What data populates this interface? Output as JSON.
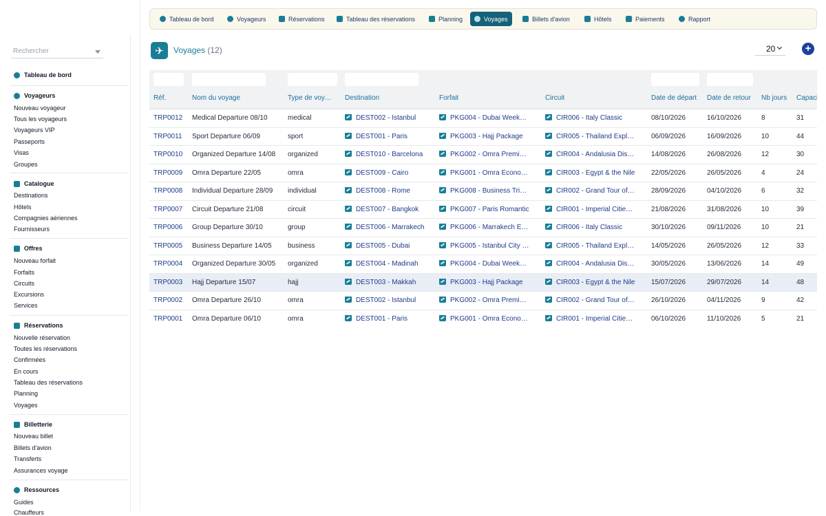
{
  "sidebar": {
    "search_placeholder": "Rechercher",
    "dashboard_label": "Tableau de bord",
    "sections": [
      {
        "title": "Voyageurs",
        "icon": "user-icon",
        "items": [
          "Nouveau voyageur",
          "Tous les voyageurs",
          "Voyageurs VIP",
          "Passeports",
          "Visas",
          "Groupes"
        ]
      },
      {
        "title": "Catalogue",
        "icon": "catalog-icon",
        "items": [
          "Destinations",
          "Hôtels",
          "Compagnies aériennes",
          "Fournisseurs"
        ]
      },
      {
        "title": "Offres",
        "icon": "offer-icon",
        "items": [
          "Nouveau forfait",
          "Forfaits",
          "Circuits",
          "Excursions",
          "Services"
        ]
      },
      {
        "title": "Réservations",
        "icon": "booking-icon",
        "items": [
          "Nouvelle réservation",
          "Toutes les réservations",
          "Confirmées",
          "En cours",
          "Tableau des réservations",
          "Planning",
          "Voyages"
        ]
      },
      {
        "title": "Billetterie",
        "icon": "ticket-icon",
        "items": [
          "Nouveau billet",
          "Billets d'avion",
          "Transferts",
          "Assurances voyage"
        ]
      },
      {
        "title": "Ressources",
        "icon": "resources-icon",
        "items": [
          "Guides",
          "Chauffeurs"
        ]
      }
    ]
  },
  "topnav": {
    "items": [
      {
        "label": "Tableau de bord",
        "icon": "dashboard-icon"
      },
      {
        "label": "Voyageurs",
        "icon": "user-icon"
      },
      {
        "label": "Réservations",
        "icon": "booking-icon"
      },
      {
        "label": "Tableau des réservations",
        "icon": "list-icon"
      },
      {
        "label": "Planning",
        "icon": "calendar-icon"
      },
      {
        "label": "Voyages",
        "icon": "globe-icon"
      },
      {
        "label": "Billets d'avion",
        "icon": "plane-icon"
      },
      {
        "label": "Hôtels",
        "icon": "hotel-icon"
      },
      {
        "label": "Paiements",
        "icon": "payment-icon"
      },
      {
        "label": "Rapport",
        "icon": "report-icon"
      }
    ],
    "active": "Voyages"
  },
  "header": {
    "title": "Voyages",
    "count": "(12)",
    "per_page": "20",
    "add_symbol": "+"
  },
  "table": {
    "columns": [
      "Réf.",
      "Nom du voyage",
      "Type de voy…",
      "Destination",
      "Forfait",
      "Circuit",
      "Date de départ",
      "Date de retour",
      "Nb jours",
      "Capaci"
    ],
    "rows": [
      {
        "ref": "TRP0012",
        "name": "Medical Departure 08/10",
        "type": "medical",
        "destination": "DEST002 - Istanbul",
        "forfait": "PKG004 - Dubai Week…",
        "circuit": "CIR006 - Italy Classic",
        "depart": "08/10/2026",
        "retour": "16/10/2026",
        "jours": "8",
        "capacite": "31"
      },
      {
        "ref": "TRP0011",
        "name": "Sport Departure 06/09",
        "type": "sport",
        "destination": "DEST001 - Paris",
        "forfait": "PKG003 - Hajj Package",
        "circuit": "CIR005 - Thailand Expl…",
        "depart": "06/09/2026",
        "retour": "16/09/2026",
        "jours": "10",
        "capacite": "44"
      },
      {
        "ref": "TRP0010",
        "name": "Organized Departure 14/08",
        "type": "organized",
        "destination": "DEST010 - Barcelona",
        "forfait": "PKG002 - Omra Premi…",
        "circuit": "CIR004 - Andalusia Dis…",
        "depart": "14/08/2026",
        "retour": "26/08/2026",
        "jours": "12",
        "capacite": "30"
      },
      {
        "ref": "TRP0009",
        "name": "Omra Departure 22/05",
        "type": "omra",
        "destination": "DEST009 - Cairo",
        "forfait": "PKG001 - Omra Econo…",
        "circuit": "CIR003 - Egypt & the Nile",
        "depart": "22/05/2026",
        "retour": "26/05/2026",
        "jours": "4",
        "capacite": "24"
      },
      {
        "ref": "TRP0008",
        "name": "Individual Departure 28/09",
        "type": "individual",
        "destination": "DEST008 - Rome",
        "forfait": "PKG008 - Business Tri…",
        "circuit": "CIR002 - Grand Tour of…",
        "depart": "28/09/2026",
        "retour": "04/10/2026",
        "jours": "6",
        "capacite": "32"
      },
      {
        "ref": "TRP0007",
        "name": "Circuit Departure 21/08",
        "type": "circuit",
        "destination": "DEST007 - Bangkok",
        "forfait": "PKG007 - Paris Romantic",
        "circuit": "CIR001 - Imperial Citie…",
        "depart": "21/08/2026",
        "retour": "31/08/2026",
        "jours": "10",
        "capacite": "39"
      },
      {
        "ref": "TRP0006",
        "name": "Group Departure 30/10",
        "type": "group",
        "destination": "DEST006 - Marrakech",
        "forfait": "PKG006 - Marrakech E…",
        "circuit": "CIR006 - Italy Classic",
        "depart": "30/10/2026",
        "retour": "09/11/2026",
        "jours": "10",
        "capacite": "21"
      },
      {
        "ref": "TRP0005",
        "name": "Business Departure 14/05",
        "type": "business",
        "destination": "DEST005 - Dubai",
        "forfait": "PKG005 - Istanbul City …",
        "circuit": "CIR005 - Thailand Expl…",
        "depart": "14/05/2026",
        "retour": "26/05/2026",
        "jours": "12",
        "capacite": "33"
      },
      {
        "ref": "TRP0004",
        "name": "Organized Departure 30/05",
        "type": "organized",
        "destination": "DEST004 - Madinah",
        "forfait": "PKG004 - Dubai Week…",
        "circuit": "CIR004 - Andalusia Dis…",
        "depart": "30/05/2026",
        "retour": "13/06/2026",
        "jours": "14",
        "capacite": "49"
      },
      {
        "ref": "TRP0003",
        "name": "Hajj Departure 15/07",
        "type": "hajj",
        "destination": "DEST003 - Makkah",
        "forfait": "PKG003 - Hajj Package",
        "circuit": "CIR003 - Egypt & the Nile",
        "depart": "15/07/2026",
        "retour": "29/07/2026",
        "jours": "14",
        "capacite": "48"
      },
      {
        "ref": "TRP0002",
        "name": "Omra Departure 26/10",
        "type": "omra",
        "destination": "DEST002 - Istanbul",
        "forfait": "PKG002 - Omra Premi…",
        "circuit": "CIR002 - Grand Tour of…",
        "depart": "26/10/2026",
        "retour": "04/11/2026",
        "jours": "9",
        "capacite": "42"
      },
      {
        "ref": "TRP0001",
        "name": "Omra Departure 06/10",
        "type": "omra",
        "destination": "DEST001 - Paris",
        "forfait": "PKG001 - Omra Econo…",
        "circuit": "CIR001 - Imperial Citie…",
        "depart": "06/10/2026",
        "retour": "11/10/2026",
        "jours": "5",
        "capacite": "21"
      }
    ],
    "highlighted_row": "TRP0003"
  },
  "colors": {
    "accent": "#1a7d96",
    "active_nav": "#16627a",
    "link": "#1e3a8a",
    "add_button": "#1d3f9e"
  }
}
